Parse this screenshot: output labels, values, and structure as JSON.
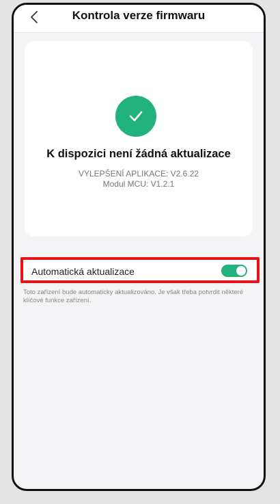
{
  "header": {
    "title": "Kontrola verze firmwaru",
    "back_icon": "chevron-left-icon"
  },
  "status_card": {
    "icon": "check-icon",
    "icon_color": "#22b27e",
    "title": "K dispozici není žádná aktualizace",
    "app_version": "VYLEPŠENÍ APLIKACE: V2.6.22",
    "mcu_version": "Modul MCU: V1.2.1"
  },
  "auto_update": {
    "label": "Automatická aktualizace",
    "enabled": true,
    "highlight_color": "#e8121a",
    "toggle_color": "#22b27e"
  },
  "note": {
    "text": "Toto zařízení bude automaticky aktualizováno. Je však třeba potvrdit některé klíčové funkce zařízení."
  }
}
